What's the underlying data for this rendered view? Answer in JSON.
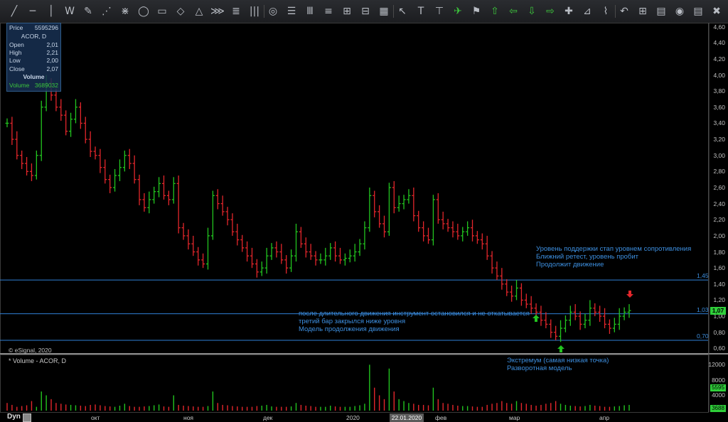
{
  "toolbar": {
    "tools": [
      {
        "icon": "line-tool-icon",
        "glyph": "╱"
      },
      {
        "icon": "horizontal-line-icon",
        "glyph": "─"
      },
      {
        "icon": "vertical-line-icon",
        "glyph": "│"
      },
      {
        "icon": "pattern-tool-icon",
        "glyph": "W"
      },
      {
        "icon": "pencil-icon",
        "glyph": "✎"
      },
      {
        "icon": "fan-tool-icon",
        "glyph": "⋰"
      },
      {
        "icon": "gann-fan-icon",
        "glyph": "⋇"
      },
      {
        "icon": "ellipse-icon",
        "glyph": "◯"
      },
      {
        "icon": "rectangle-icon",
        "glyph": "▭"
      },
      {
        "icon": "diamond-icon",
        "glyph": "◇"
      },
      {
        "icon": "triangle-icon",
        "glyph": "△"
      },
      {
        "icon": "regression-icon",
        "glyph": "⋙"
      },
      {
        "icon": "parallel-lines-icon",
        "glyph": "≣"
      },
      {
        "icon": "cycle-lines-icon",
        "glyph": "|||"
      },
      {
        "icon": "spiral-icon",
        "glyph": "◎"
      },
      {
        "icon": "fibonacci-icon",
        "glyph": "☰"
      },
      {
        "icon": "fib-time-icon",
        "glyph": "Ⅲ"
      },
      {
        "icon": "levels-icon",
        "glyph": "≡"
      },
      {
        "icon": "speed-lines-icon",
        "glyph": "⊞"
      },
      {
        "icon": "channel-icon",
        "glyph": "⊟"
      },
      {
        "icon": "grid-icon",
        "glyph": "▦"
      },
      {
        "icon": "cursor-icon",
        "glyph": "↖"
      },
      {
        "icon": "text-tool-icon",
        "glyph": "T"
      },
      {
        "icon": "callout-icon",
        "glyph": "⊤"
      },
      {
        "icon": "arrow-marker-icon",
        "glyph": "✈"
      },
      {
        "icon": "flag-icon",
        "glyph": "⚑"
      },
      {
        "icon": "arrow-up-icon",
        "glyph": "⇧"
      },
      {
        "icon": "arrow-left-icon",
        "glyph": "⇦"
      },
      {
        "icon": "arrow-down-icon",
        "glyph": "⇩"
      },
      {
        "icon": "arrow-right-icon",
        "glyph": "⇨"
      },
      {
        "icon": "marker-icon",
        "glyph": "✚"
      },
      {
        "icon": "chart-tool-icon",
        "glyph": "⊿"
      },
      {
        "icon": "stairs-icon",
        "glyph": "⌇"
      },
      {
        "icon": "undo-arrow-icon",
        "glyph": "↶"
      },
      {
        "icon": "table-icon",
        "glyph": "⊞"
      },
      {
        "icon": "pnf-icon",
        "glyph": "▤"
      },
      {
        "icon": "eye-icon",
        "glyph": "◉"
      },
      {
        "icon": "data-icon",
        "glyph": "▤"
      },
      {
        "icon": "delete-icon",
        "glyph": "✖"
      }
    ]
  },
  "info_box": {
    "price_label": "Price",
    "price_value": "5595296",
    "symbol": "ACOR, D",
    "open_label": "Open",
    "open_value": "2,01",
    "high_label": "High",
    "high_value": "2,21",
    "low_label": "Low",
    "low_value": "2,00",
    "close_label": "Close",
    "close_value": "2,07",
    "volume_title": "Volume",
    "volume_label": "Volume",
    "volume_value": "3689032"
  },
  "price_axis": {
    "ticks": [
      "4,60",
      "4,40",
      "4,20",
      "4,00",
      "3,80",
      "3,60",
      "3,40",
      "3,20",
      "3,00",
      "2,80",
      "2,60",
      "2,40",
      "2,20",
      "2,00",
      "1,80",
      "1,60",
      "1,40",
      "1,20",
      "1,00",
      "0,80",
      "0,60"
    ],
    "last_price": "1,07"
  },
  "levels": [
    {
      "label": "1,45",
      "value": 1.45
    },
    {
      "label": "1,03",
      "value": 1.03
    },
    {
      "label": "0,70",
      "value": 0.7
    }
  ],
  "notes": {
    "note1": [
      "Уровень поддержки стап уровнем сопротивления",
      "Ближний ретест,  уровень пробит",
      "Продолжит движение"
    ],
    "note2": [
      "после длительного движения инструмент остановился и не откатывается",
      "третий бар закрылся ниже уровня",
      "Модель продолжения движения"
    ],
    "note3": [
      "Экстремум (самая низкая точка)",
      "Разворотная модель"
    ]
  },
  "watermark": "© eSignal, 2020",
  "volume_panel": {
    "title": "* Volume - ACOR, D",
    "ticks": [
      "12000",
      "8000",
      "4000"
    ],
    "tag_value": "5595",
    "tag_value2": "3688"
  },
  "x_axis": {
    "labels": [
      "окт",
      "ноя",
      "дек",
      "2020",
      "фев",
      "мар",
      "апр"
    ],
    "date_tag": "22.01.2020",
    "interval": "Dyn"
  },
  "colors": {
    "up": "#22c41f",
    "down": "#e3262b",
    "level": "#2f7fd6",
    "note": "#3d8fe0"
  },
  "chart_data": {
    "type": "bar",
    "symbol": "ACOR, D",
    "ohlc_closes": [
      3.4,
      3.2,
      3.0,
      2.9,
      2.8,
      2.75,
      3.0,
      3.6,
      3.9,
      3.75,
      3.6,
      3.5,
      3.3,
      3.45,
      3.6,
      3.4,
      3.2,
      3.05,
      3.0,
      2.85,
      2.7,
      2.6,
      2.75,
      2.85,
      3.0,
      2.9,
      2.7,
      2.45,
      2.35,
      2.45,
      2.55,
      2.65,
      2.5,
      2.45,
      2.65,
      2.1,
      2.0,
      1.9,
      1.8,
      1.7,
      1.65,
      2.0,
      2.5,
      2.4,
      2.3,
      2.2,
      2.05,
      1.95,
      1.85,
      1.75,
      1.65,
      1.55,
      1.6,
      1.75,
      1.85,
      1.8,
      1.7,
      1.6,
      1.75,
      2.05,
      1.9,
      1.8,
      1.75,
      1.7,
      1.7,
      1.75,
      1.85,
      1.75,
      1.7,
      1.72,
      1.75,
      1.8,
      1.9,
      2.1,
      2.5,
      2.3,
      2.15,
      2.05,
      2.6,
      2.35,
      2.4,
      2.45,
      2.5,
      2.25,
      2.1,
      2.0,
      1.95,
      2.45,
      2.2,
      2.15,
      2.1,
      2.05,
      2.0,
      2.05,
      2.1,
      2.0,
      1.95,
      1.9,
      1.75,
      1.6,
      1.5,
      1.4,
      1.3,
      1.25,
      1.35,
      1.2,
      1.15,
      1.1,
      1.05,
      0.95,
      0.9,
      0.8,
      0.75,
      0.85,
      0.95,
      1.05,
      1.0,
      0.9,
      0.95,
      1.1,
      1.05,
      1.0,
      0.9,
      0.85,
      0.9,
      1.0,
      1.05,
      1.07
    ],
    "volume": [
      2,
      1.5,
      1,
      1.2,
      1.4,
      2.5,
      1,
      5,
      4,
      3,
      2,
      1.8,
      1.6,
      1.5,
      1.4,
      1.3,
      1.2,
      1.5,
      1.6,
      1.4,
      1.2,
      1.1,
      1,
      1.3,
      1.8,
      1.2,
      1,
      1,
      1.1,
      1.2,
      1.4,
      1.6,
      1.1,
      1,
      4,
      1.5,
      1.3,
      1.2,
      1.1,
      1,
      1,
      1.2,
      5,
      2,
      1.5,
      1.4,
      1.2,
      1.1,
      1,
      1,
      1,
      1.2,
      1.3,
      1.5,
      1.1,
      1,
      1,
      1,
      1.1,
      2,
      1.5,
      1.3,
      1.2,
      1,
      1,
      1,
      1.3,
      1.1,
      1,
      1,
      1,
      1.2,
      1.4,
      1.8,
      12,
      6,
      4,
      3,
      11,
      5,
      3,
      2.5,
      2,
      1.8,
      1.5,
      1.5,
      1.4,
      6,
      3,
      2,
      1.8,
      1.5,
      1.3,
      1.2,
      1.2,
      1.1,
      1,
      1,
      1.5,
      1.8,
      2,
      2.5,
      2,
      1.8,
      2.5,
      2,
      1.8,
      1.5,
      1.3,
      1.5,
      1.8,
      2,
      2.5,
      1.8,
      1.5,
      1.3,
      1.2,
      1.1,
      1.2,
      1.5,
      1.3,
      1.2,
      1,
      1,
      1.1,
      1.2,
      1.4,
      1.5
    ],
    "ylim": [
      0.55,
      4.65
    ],
    "xlabel": "",
    "ylabel": ""
  }
}
